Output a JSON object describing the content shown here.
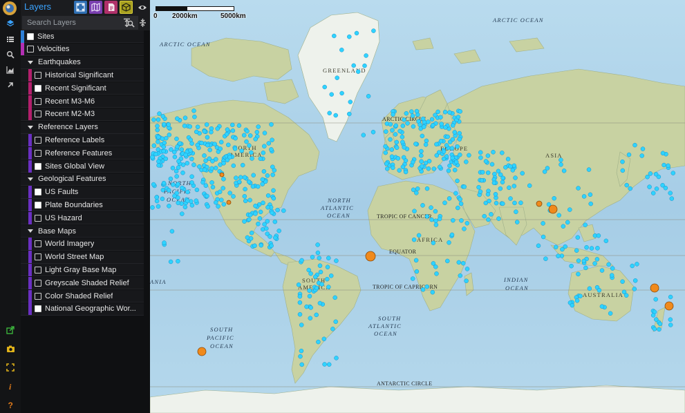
{
  "app": {
    "title": "Layers"
  },
  "toolbar": {
    "buttons": [
      {
        "name": "network-icon",
        "color": "#2f6fb3"
      },
      {
        "name": "map-icon",
        "color": "#7a3fb0"
      },
      {
        "name": "document-icon",
        "color": "#b0306a"
      },
      {
        "name": "cube-icon",
        "color": "#a8a020"
      },
      {
        "name": "eye-icon",
        "color": "#1b1c1f"
      }
    ]
  },
  "search": {
    "placeholder": "Search Layers",
    "value": ""
  },
  "layers": [
    {
      "type": "layer",
      "label": "Sites",
      "checked": true,
      "color": "#2e7fd6",
      "indent": 0
    },
    {
      "type": "layer",
      "label": "Velocities",
      "checked": false,
      "color": "#b32fb3",
      "indent": 0
    },
    {
      "type": "group",
      "label": "Earthquakes"
    },
    {
      "type": "layer",
      "label": "Historical Significant",
      "checked": false,
      "color": "#b31f6c",
      "indent": 1
    },
    {
      "type": "layer",
      "label": "Recent Significant",
      "checked": true,
      "color": "#b31f6c",
      "indent": 1
    },
    {
      "type": "layer",
      "label": "Recent M3-M6",
      "checked": false,
      "color": "#b31f6c",
      "indent": 1
    },
    {
      "type": "layer",
      "label": "Recent M2-M3",
      "checked": false,
      "color": "#b31f6c",
      "indent": 1
    },
    {
      "type": "group",
      "label": "Reference Layers"
    },
    {
      "type": "layer",
      "label": "Reference Labels",
      "checked": false,
      "color": "#6a2fc2",
      "indent": 1
    },
    {
      "type": "layer",
      "label": "Reference Features",
      "checked": false,
      "color": "#6a2fc2",
      "indent": 1
    },
    {
      "type": "layer",
      "label": "Sites Global View",
      "checked": true,
      "color": "#6a2fc2",
      "indent": 1
    },
    {
      "type": "group",
      "label": "Geological Features"
    },
    {
      "type": "layer",
      "label": "US Faults",
      "checked": true,
      "color": "#6a2fc2",
      "indent": 1
    },
    {
      "type": "layer",
      "label": "Plate Boundaries",
      "checked": true,
      "color": "#6a2fc2",
      "indent": 1
    },
    {
      "type": "layer",
      "label": "US Hazard",
      "checked": false,
      "color": "#6a2fc2",
      "indent": 1
    },
    {
      "type": "group",
      "label": "Base Maps"
    },
    {
      "type": "layer",
      "label": "World Imagery",
      "checked": false,
      "color": "#6a2fc2",
      "indent": 1
    },
    {
      "type": "layer",
      "label": "World Street Map",
      "checked": false,
      "color": "#6a2fc2",
      "indent": 1
    },
    {
      "type": "layer",
      "label": "Light Gray Base Map",
      "checked": false,
      "color": "#6a2fc2",
      "indent": 1
    },
    {
      "type": "layer",
      "label": "Greyscale Shaded Relief",
      "checked": false,
      "color": "#6a2fc2",
      "indent": 1
    },
    {
      "type": "layer",
      "label": "Color Shaded Relief",
      "checked": false,
      "color": "#6a2fc2",
      "indent": 1
    },
    {
      "type": "layer",
      "label": "National Geographic Wor...",
      "checked": true,
      "color": "#6a2fc2",
      "indent": 1
    }
  ],
  "left_icons": {
    "top": [
      "layers-icon",
      "list-icon",
      "search-icon",
      "chart-icon",
      "arrow-icon"
    ],
    "bottom": [
      {
        "name": "external-link-icon",
        "color": "#3fbf3f"
      },
      {
        "name": "camera-icon",
        "color": "#e0b21a"
      },
      {
        "name": "fullscreen-icon",
        "color": "#e0b21a"
      },
      {
        "name": "info-icon",
        "color": "#e07a1a"
      },
      {
        "name": "help-icon",
        "color": "#e07a1a"
      }
    ]
  },
  "scale": {
    "zero": "0",
    "mid": "2000km",
    "max": "5000km"
  },
  "map": {
    "labels": {
      "arctic_ocean_left": "ARCTIC OCEAN",
      "arctic_ocean_right": "ARCTIC OCEAN",
      "greenland": "GREENLAND",
      "arctic_circle": "ARCTIC CIRCLE",
      "north_america_1": "NORTH",
      "north_america_2": "AMERICA",
      "europe": "EUROPE",
      "asia": "ASIA",
      "north_pacific_1": "NORTH",
      "north_pacific_2": "PACIFIC",
      "north_pacific_3": "OCEAN",
      "north_atlantic_1": "NORTH",
      "north_atlantic_2": "ATLANTIC",
      "north_atlantic_3": "OCEAN",
      "tropic_cancer": "TROPIC OF CANCER",
      "africa": "AFRICA",
      "equator": "EQUATOR",
      "south_america_1": "SOUTH",
      "south_america_2": "AMERICA",
      "tropic_capricorn": "TROPIC OF CAPRICORN",
      "indian_ocean_1": "INDIAN",
      "indian_ocean_2": "OCEAN",
      "australia": "AUSTRALIA",
      "south_atlantic_1": "SOUTH",
      "south_atlantic_2": "ATLANTIC",
      "south_atlantic_3": "OCEAN",
      "south_pacific_1": "SOUTH",
      "south_pacific_2": "PACIFIC",
      "south_pacific_3": "OCEAN",
      "antarctic_circle": "ANTARCTIC CIRCLE",
      "oceania_edge": "ANIA"
    },
    "colors": {
      "ocean": "#a9cfe6",
      "land": "#c9d3a4",
      "ice": "#f2f4f2",
      "site_dot": "#2fd3ff",
      "quake_dot": "#f08a1c"
    }
  }
}
